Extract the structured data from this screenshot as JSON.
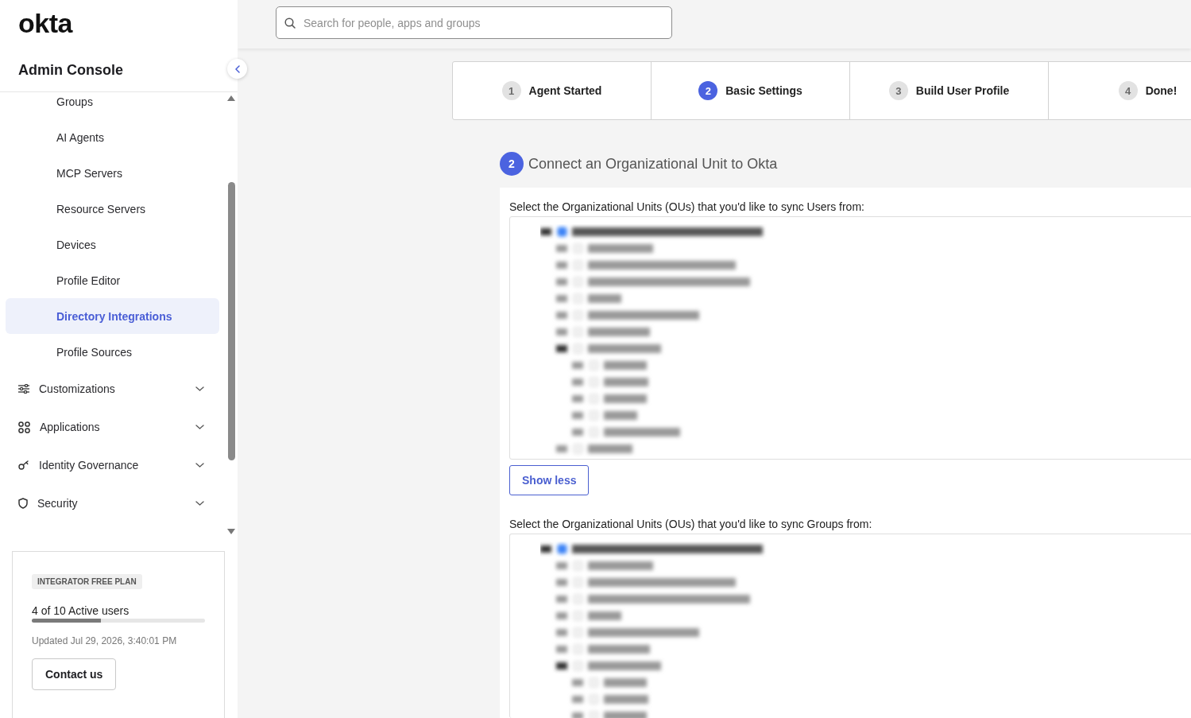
{
  "sidebar": {
    "logo": "okta",
    "title": "Admin Console",
    "nav_items": [
      {
        "kind": "sub",
        "label": "Groups",
        "selected": false
      },
      {
        "kind": "sub",
        "label": "AI Agents",
        "selected": false
      },
      {
        "kind": "sub",
        "label": "MCP Servers",
        "selected": false
      },
      {
        "kind": "sub",
        "label": "Resource Servers",
        "selected": false
      },
      {
        "kind": "sub",
        "label": "Devices",
        "selected": false
      },
      {
        "kind": "sub",
        "label": "Profile Editor",
        "selected": false
      },
      {
        "kind": "sub",
        "label": "Directory Integrations",
        "selected": true
      },
      {
        "kind": "sub",
        "label": "Profile Sources",
        "selected": false
      },
      {
        "kind": "section",
        "label": "Customizations",
        "selected": false,
        "expanded": false
      },
      {
        "kind": "section",
        "label": "Applications",
        "selected": false,
        "expanded": false
      },
      {
        "kind": "section",
        "label": "Identity Governance",
        "selected": false,
        "expanded": false
      },
      {
        "kind": "section",
        "label": "Security",
        "selected": false,
        "expanded": false
      }
    ],
    "plan": {
      "badge": "INTEGRATOR FREE PLAN",
      "usage": "4 of 10 Active users",
      "level": 0.4,
      "updated": "Updated Jul 29, 2026, 3:40:01 PM",
      "button": "Contact us"
    }
  },
  "search": {
    "placeholder": "Search for people, apps and groups"
  },
  "steps": [
    {
      "number": "1",
      "label": "Agent Started",
      "selected": false
    },
    {
      "number": "2",
      "label": "Basic Settings",
      "selected": true
    },
    {
      "number": "3",
      "label": "Build User Profile",
      "selected": false
    },
    {
      "number": "4",
      "label": "Done!",
      "selected": false
    }
  ],
  "section": {
    "number": "2",
    "title": "Connect an Organizational Unit to Okta",
    "ou_pickers": [
      {
        "label": "Select the Organizational Units (OUs) that you'd like to sync Users from:",
        "button": "Show less"
      },
      {
        "label": "Select the Organizational Units (OUs) that you'd like to sync Groups from:"
      }
    ]
  }
}
